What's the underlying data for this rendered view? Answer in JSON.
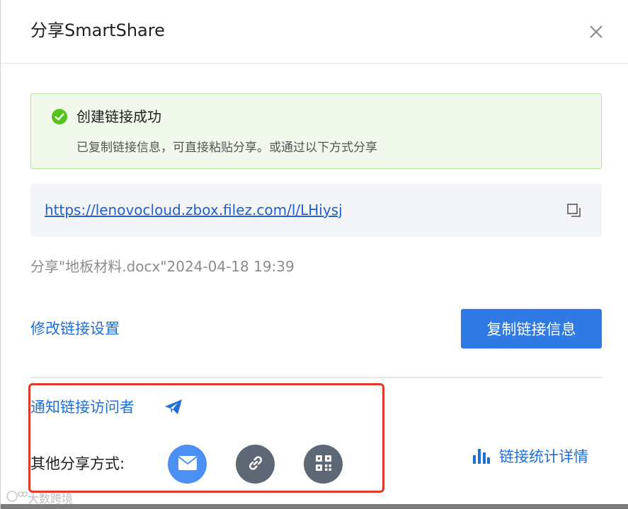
{
  "dialog": {
    "title": "分享SmartShare"
  },
  "success": {
    "title": "创建链接成功",
    "subtitle": "已复制链接信息，可直接粘贴分享。或通过以下方式分享",
    "color": "#52c41a"
  },
  "link": {
    "url": "https://lenovocloud.zbox.filez.com/l/LHiysj"
  },
  "share_meta": "分享\"地板材料.docx\"2024-04-18 19:39",
  "actions": {
    "modify_label": "修改链接设置",
    "copy_info_label": "复制链接信息"
  },
  "notify": {
    "label": "通知链接访问者"
  },
  "other_share": {
    "label": "其他分享方式:",
    "buttons": [
      {
        "icon": "email-icon",
        "color": "#4d90f5"
      },
      {
        "icon": "link-icon",
        "color": "#5d6776"
      },
      {
        "icon": "qrcode-icon",
        "color": "#5d6776"
      }
    ]
  },
  "stats": {
    "label": "链接统计详情"
  },
  "watermark": {
    "text": "大数跨境"
  },
  "colors": {
    "accent": "#2f7ae5",
    "link": "#1f6fd8",
    "highlight": "#e2382c"
  }
}
